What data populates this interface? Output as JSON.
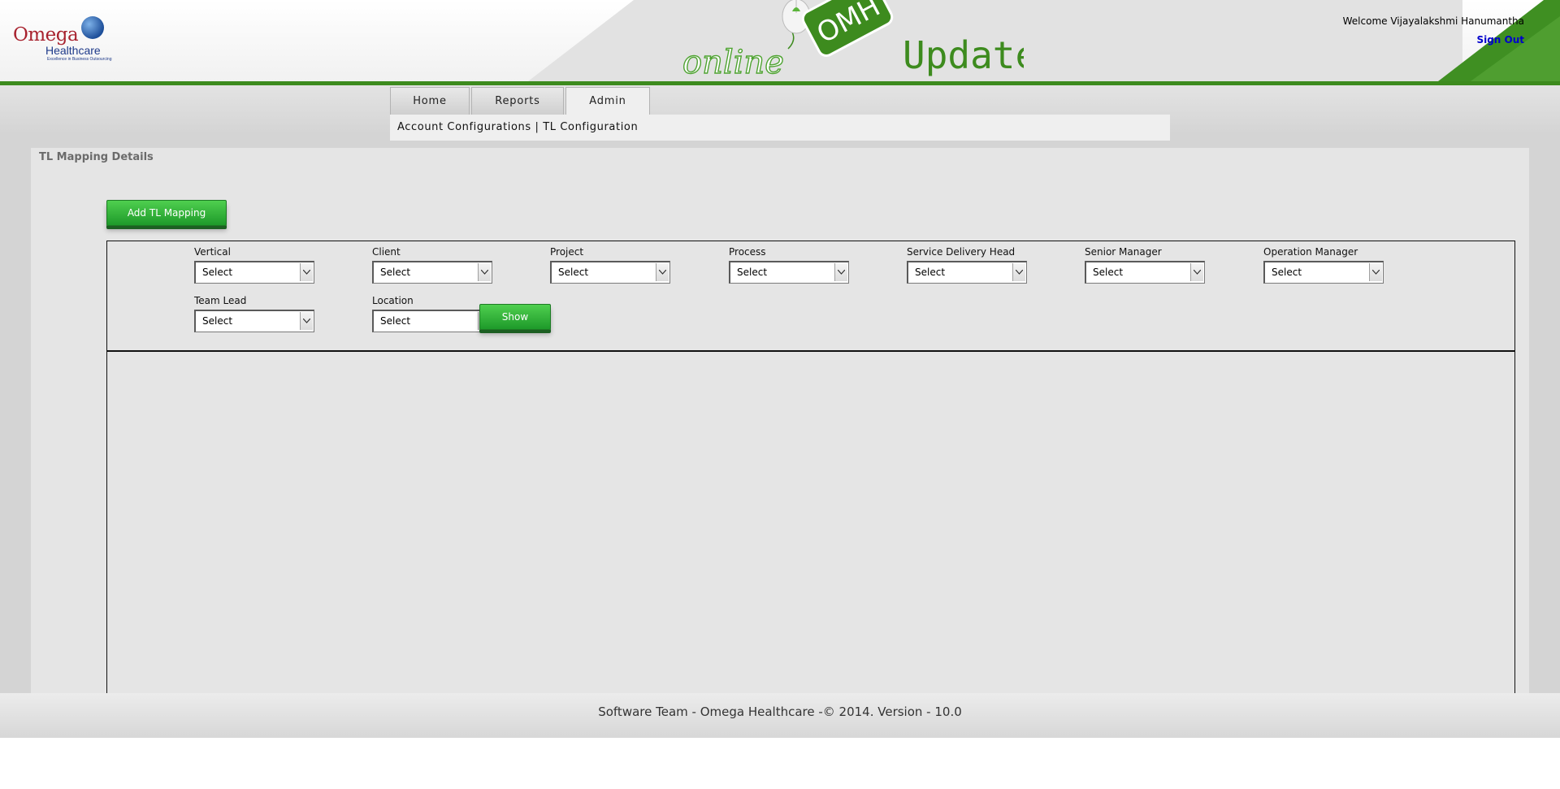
{
  "header": {
    "logo": {
      "line1": "Omega",
      "line2": "Healthcare",
      "tagline": "Excellence in Business Outsourcing"
    },
    "app_title": {
      "prefix": "online",
      "badge": "OMH",
      "suffix": "Update"
    },
    "welcome_text": "Welcome Vijayalakshmi Hanumantha",
    "sign_out": "Sign Out"
  },
  "tabs": [
    {
      "label": "Home"
    },
    {
      "label": "Reports"
    },
    {
      "label": "Admin",
      "active": true
    }
  ],
  "subnav": {
    "account_configurations": "Account Configurations",
    "separator": "|",
    "tl_configuration": "TL Configuration"
  },
  "page": {
    "title": "TL Mapping Details",
    "add_button": "Add TL Mapping",
    "show_button": "Show"
  },
  "filters": [
    {
      "label": "Vertical",
      "value": "Select"
    },
    {
      "label": "Client",
      "value": "Select"
    },
    {
      "label": "Project",
      "value": "Select"
    },
    {
      "label": "Process",
      "value": "Select"
    },
    {
      "label": "Service Delivery Head",
      "value": "Select"
    },
    {
      "label": "Senior Manager",
      "value": "Select"
    },
    {
      "label": "Operation Manager",
      "value": "Select"
    },
    {
      "label": "Team Lead",
      "value": "Select"
    },
    {
      "label": "Location",
      "value": "Select"
    }
  ],
  "footer": {
    "text": "Software Team - Omega Healthcare -© 2014. Version - 10.0"
  },
  "colors": {
    "brand_green": "#3d8b1e",
    "button_green": "#1e9a2a",
    "link_blue": "#0000cc"
  }
}
